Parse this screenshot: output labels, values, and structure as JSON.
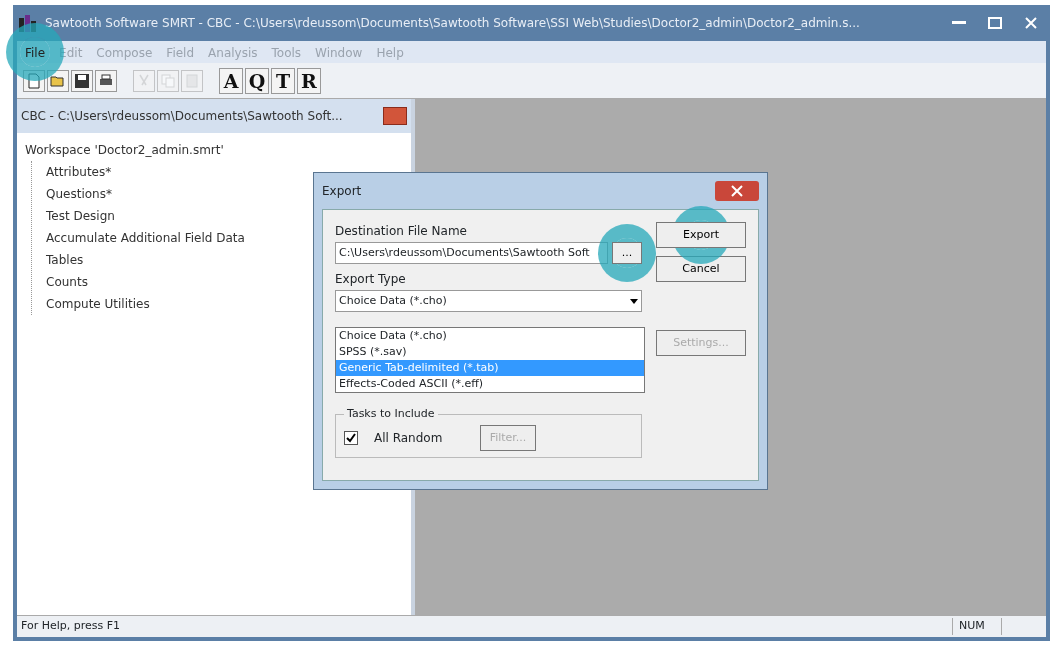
{
  "window": {
    "title": "Sawtooth Software SMRT - CBC - C:\\Users\\rdeussom\\Documents\\Sawtooth Software\\SSI Web\\Studies\\Doctor2_admin\\Doctor2_admin.s..."
  },
  "menu": [
    {
      "label": "File",
      "disabled": false,
      "highlighted": true
    },
    {
      "label": "Edit",
      "disabled": true,
      "highlighted": false
    },
    {
      "label": "Compose",
      "disabled": true,
      "highlighted": false
    },
    {
      "label": "Field",
      "disabled": true,
      "highlighted": false
    },
    {
      "label": "Analysis",
      "disabled": true,
      "highlighted": false
    },
    {
      "label": "Tools",
      "disabled": true,
      "highlighted": false
    },
    {
      "label": "Window",
      "disabled": true,
      "highlighted": false
    },
    {
      "label": "Help",
      "disabled": true,
      "highlighted": false
    }
  ],
  "toolbar": [
    {
      "kind": "icon",
      "disabled": false
    },
    {
      "kind": "icon",
      "disabled": false
    },
    {
      "kind": "icon",
      "disabled": false
    },
    {
      "kind": "icon",
      "disabled": false
    },
    {
      "kind": "sep"
    },
    {
      "kind": "icon",
      "disabled": true
    },
    {
      "kind": "icon",
      "disabled": true
    },
    {
      "kind": "icon",
      "disabled": true
    },
    {
      "kind": "sep"
    },
    {
      "kind": "letter",
      "label": "A"
    },
    {
      "kind": "letter",
      "label": "Q"
    },
    {
      "kind": "letter",
      "label": "T"
    },
    {
      "kind": "letter",
      "label": "R"
    }
  ],
  "study_window": {
    "title": "CBC - C:\\Users\\rdeussom\\Documents\\Sawtooth Soft...",
    "tree": [
      {
        "label": "Workspace 'Doctor2_admin.smrt'",
        "children": [
          {
            "label": "Attributes*"
          },
          {
            "label": "Questions*"
          },
          {
            "label": "Test Design"
          },
          {
            "label": "Accumulate Additional Field Data"
          },
          {
            "label": "Tables"
          },
          {
            "label": "Counts"
          },
          {
            "label": "Compute Utilities"
          }
        ]
      }
    ]
  },
  "dialog": {
    "title": "Export",
    "destination_label": "Destination File Name",
    "destination_value": "C:\\Users\\rdeussom\\Documents\\Sawtooth Soft",
    "browse": {
      "label": "...",
      "highlighted": true
    },
    "export_type_label": "Export Type",
    "export_type_value": "Choice Data (*.cho)",
    "options": [
      {
        "label": "Choice Data (*.cho)",
        "selected": false
      },
      {
        "label": "SPSS (*.sav)",
        "selected": false
      },
      {
        "label": "Generic Tab-delimited (*.tab)",
        "selected": true
      },
      {
        "label": "Effects-Coded ASCII (*.eff)",
        "selected": false
      }
    ],
    "side_button": {
      "label": "Settings...",
      "disabled": true
    },
    "tasks_label": "Tasks to Include",
    "all_random": {
      "label": "All Random",
      "checked": true
    },
    "filter": {
      "label": "Filter...",
      "disabled": true
    },
    "buttons": [
      {
        "label": "Export",
        "highlighted": true
      },
      {
        "label": "Cancel",
        "highlighted": false
      }
    ]
  },
  "status_bar": {
    "text": "For Help, press F1",
    "indicator": "NUM"
  }
}
